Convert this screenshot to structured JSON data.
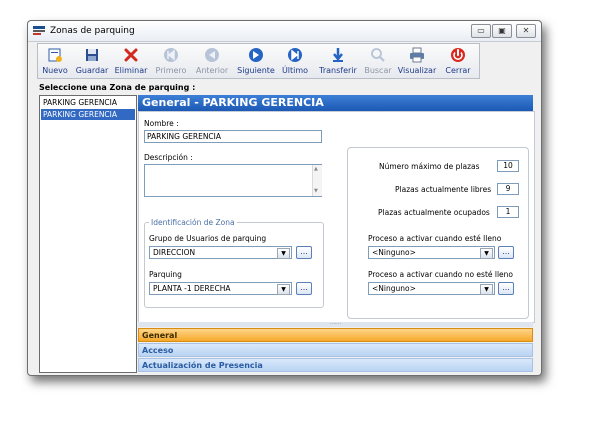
{
  "window": {
    "title": "Zonas de parquing",
    "controls": {
      "minimize": "▭",
      "maximize": "▣",
      "close": "✕"
    }
  },
  "toolbar": {
    "items": [
      {
        "label": "Nuevo",
        "icon": "new-document-icon",
        "enabled": true
      },
      {
        "label": "Guardar",
        "icon": "save-icon",
        "enabled": true
      },
      {
        "label": "Eliminar",
        "icon": "delete-icon",
        "enabled": true
      },
      {
        "label": "Primero",
        "icon": "first-record-icon",
        "enabled": false
      },
      {
        "label": "Anterior",
        "icon": "previous-record-icon",
        "enabled": false
      },
      {
        "label": "Siguiente",
        "icon": "next-record-icon",
        "enabled": true
      },
      {
        "label": "Último",
        "icon": "last-record-icon",
        "enabled": true
      },
      {
        "label": "Transferir",
        "icon": "transfer-icon",
        "enabled": true
      },
      {
        "label": "Buscar",
        "icon": "search-icon",
        "enabled": false
      },
      {
        "label": "Visualizar",
        "icon": "print-preview-icon",
        "enabled": true
      },
      {
        "label": "Cerrar",
        "icon": "close-icon",
        "enabled": true
      }
    ]
  },
  "sidebar": {
    "title": "Seleccione una Zona de parquing :",
    "items": [
      {
        "label": "PARKING GERENCIA",
        "selected": false
      },
      {
        "label": "PARKING GERENCIA",
        "selected": true
      }
    ]
  },
  "main": {
    "header": "General - PARKING GERENCIA",
    "nombre_label": "Nombre :",
    "nombre_value": "PARKING GERENCIA",
    "descripcion_label": "Descripción :",
    "descripcion_value": "",
    "group_title": "Identificación de Zona",
    "grupo_label": "Grupo de Usuarios de parquing",
    "grupo_value": "DIRECCION",
    "parquing_label": "Parquing",
    "parquing_value": "PLANTA -1 DERECHA",
    "max_plazas_label": "Número máximo de plazas",
    "max_plazas_value": "10",
    "libres_label": "Plazas actualmente libres",
    "libres_value": "9",
    "ocupados_label": "Plazas actualmente ocupados",
    "ocupados_value": "1",
    "proceso_lleno_label": "Proceso a activar cuando esté lleno",
    "proceso_lleno_value": "<Ninguno>",
    "proceso_no_lleno_label": "Proceso a activar cuando no esté lleno",
    "proceso_no_lleno_value": "<Ninguno>",
    "browse_label": "..."
  },
  "sections": [
    {
      "label": "General",
      "active": true
    },
    {
      "label": "Acceso",
      "active": false
    },
    {
      "label": "Actualización de Presencia",
      "active": false
    }
  ],
  "colors": {
    "header": "#1c59b5",
    "active_section": "#f6a92b",
    "inactive_section": "#b8d3f2"
  }
}
